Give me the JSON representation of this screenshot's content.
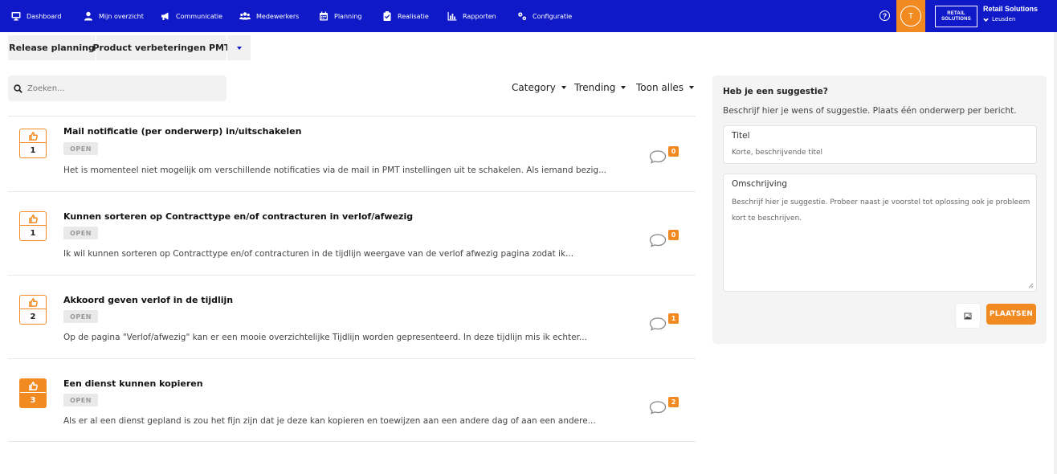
{
  "nav": {
    "items": [
      {
        "label": "Dashboard",
        "icon": "monitor-icon"
      },
      {
        "label": "Mijn overzicht",
        "icon": "user-icon"
      },
      {
        "label": "Communicatie",
        "icon": "megaphone-icon"
      },
      {
        "label": "Medewerkers",
        "icon": "users-icon"
      },
      {
        "label": "Planning",
        "icon": "calendar-icon"
      },
      {
        "label": "Realisatie",
        "icon": "clipboard-icon"
      },
      {
        "label": "Rapporten",
        "icon": "bar-chart-icon"
      },
      {
        "label": "Configuratie",
        "icon": "cogs-icon"
      }
    ],
    "help_icon": "?",
    "avatar_initial": "T",
    "brand_logo": [
      "RETAIL",
      "SOLUTIONS"
    ],
    "company_name": "Retail Solutions",
    "company_location": "Leusden"
  },
  "breadcrumb": {
    "first": "Release planning",
    "second": "Product verbeteringen PMT"
  },
  "search": {
    "placeholder": "Zoeken..."
  },
  "filters": {
    "category": "Category",
    "trending": "Trending",
    "show": "Toon alles"
  },
  "items": [
    {
      "votes": "1",
      "title": "Mail notificatie (per onderwerp) in/uitschakelen",
      "status": "OPEN",
      "description": "Het is momenteel niet mogelijk om verschillende notificaties via de mail in PMT instellingen uit te schakelen. Als iemand bezig...",
      "comments": "0",
      "voted": false
    },
    {
      "votes": "1",
      "title": "Kunnen sorteren op Contracttype en/of contracturen in verlof/afwezig",
      "status": "OPEN",
      "description": "Ik wil kunnen sorteren op Contracttype en/of contracturen in de tijdlijn weergave van de verlof afwezig pagina zodat ik...",
      "comments": "0",
      "voted": false
    },
    {
      "votes": "2",
      "title": "Akkoord geven verlof in de tijdlijn",
      "status": "OPEN",
      "description": "Op de pagina \"Verlof/afwezig\" kan er een mooie overzichtelijke Tijdlijn worden gepresenteerd. In deze tijdlijn mis ik echter...",
      "comments": "1",
      "voted": false
    },
    {
      "votes": "3",
      "title": "Een dienst kunnen kopieren",
      "status": "OPEN",
      "description": "Als er al een dienst gepland is zou het fijn zijn dat je deze kan kopieren en toewijzen aan een andere dag of aan een andere...",
      "comments": "2",
      "voted": true
    }
  ],
  "suggestion": {
    "title": "Heb je een suggestie?",
    "intro": "Beschrijf hier je wens of suggestie. Plaats één onderwerp per bericht.",
    "title_label": "Titel",
    "title_placeholder": "Korte, beschrijvende titel",
    "description_label": "Omschrijving",
    "description_placeholder": "Beschrijf hier je suggestie. Probeer naast je voorstel tot oplossing ook je probleem kort te beschrijven.",
    "submit_label": "PLAATSEN"
  },
  "colors": {
    "nav_bg": "#1019c7",
    "accent": "#f28a22"
  }
}
